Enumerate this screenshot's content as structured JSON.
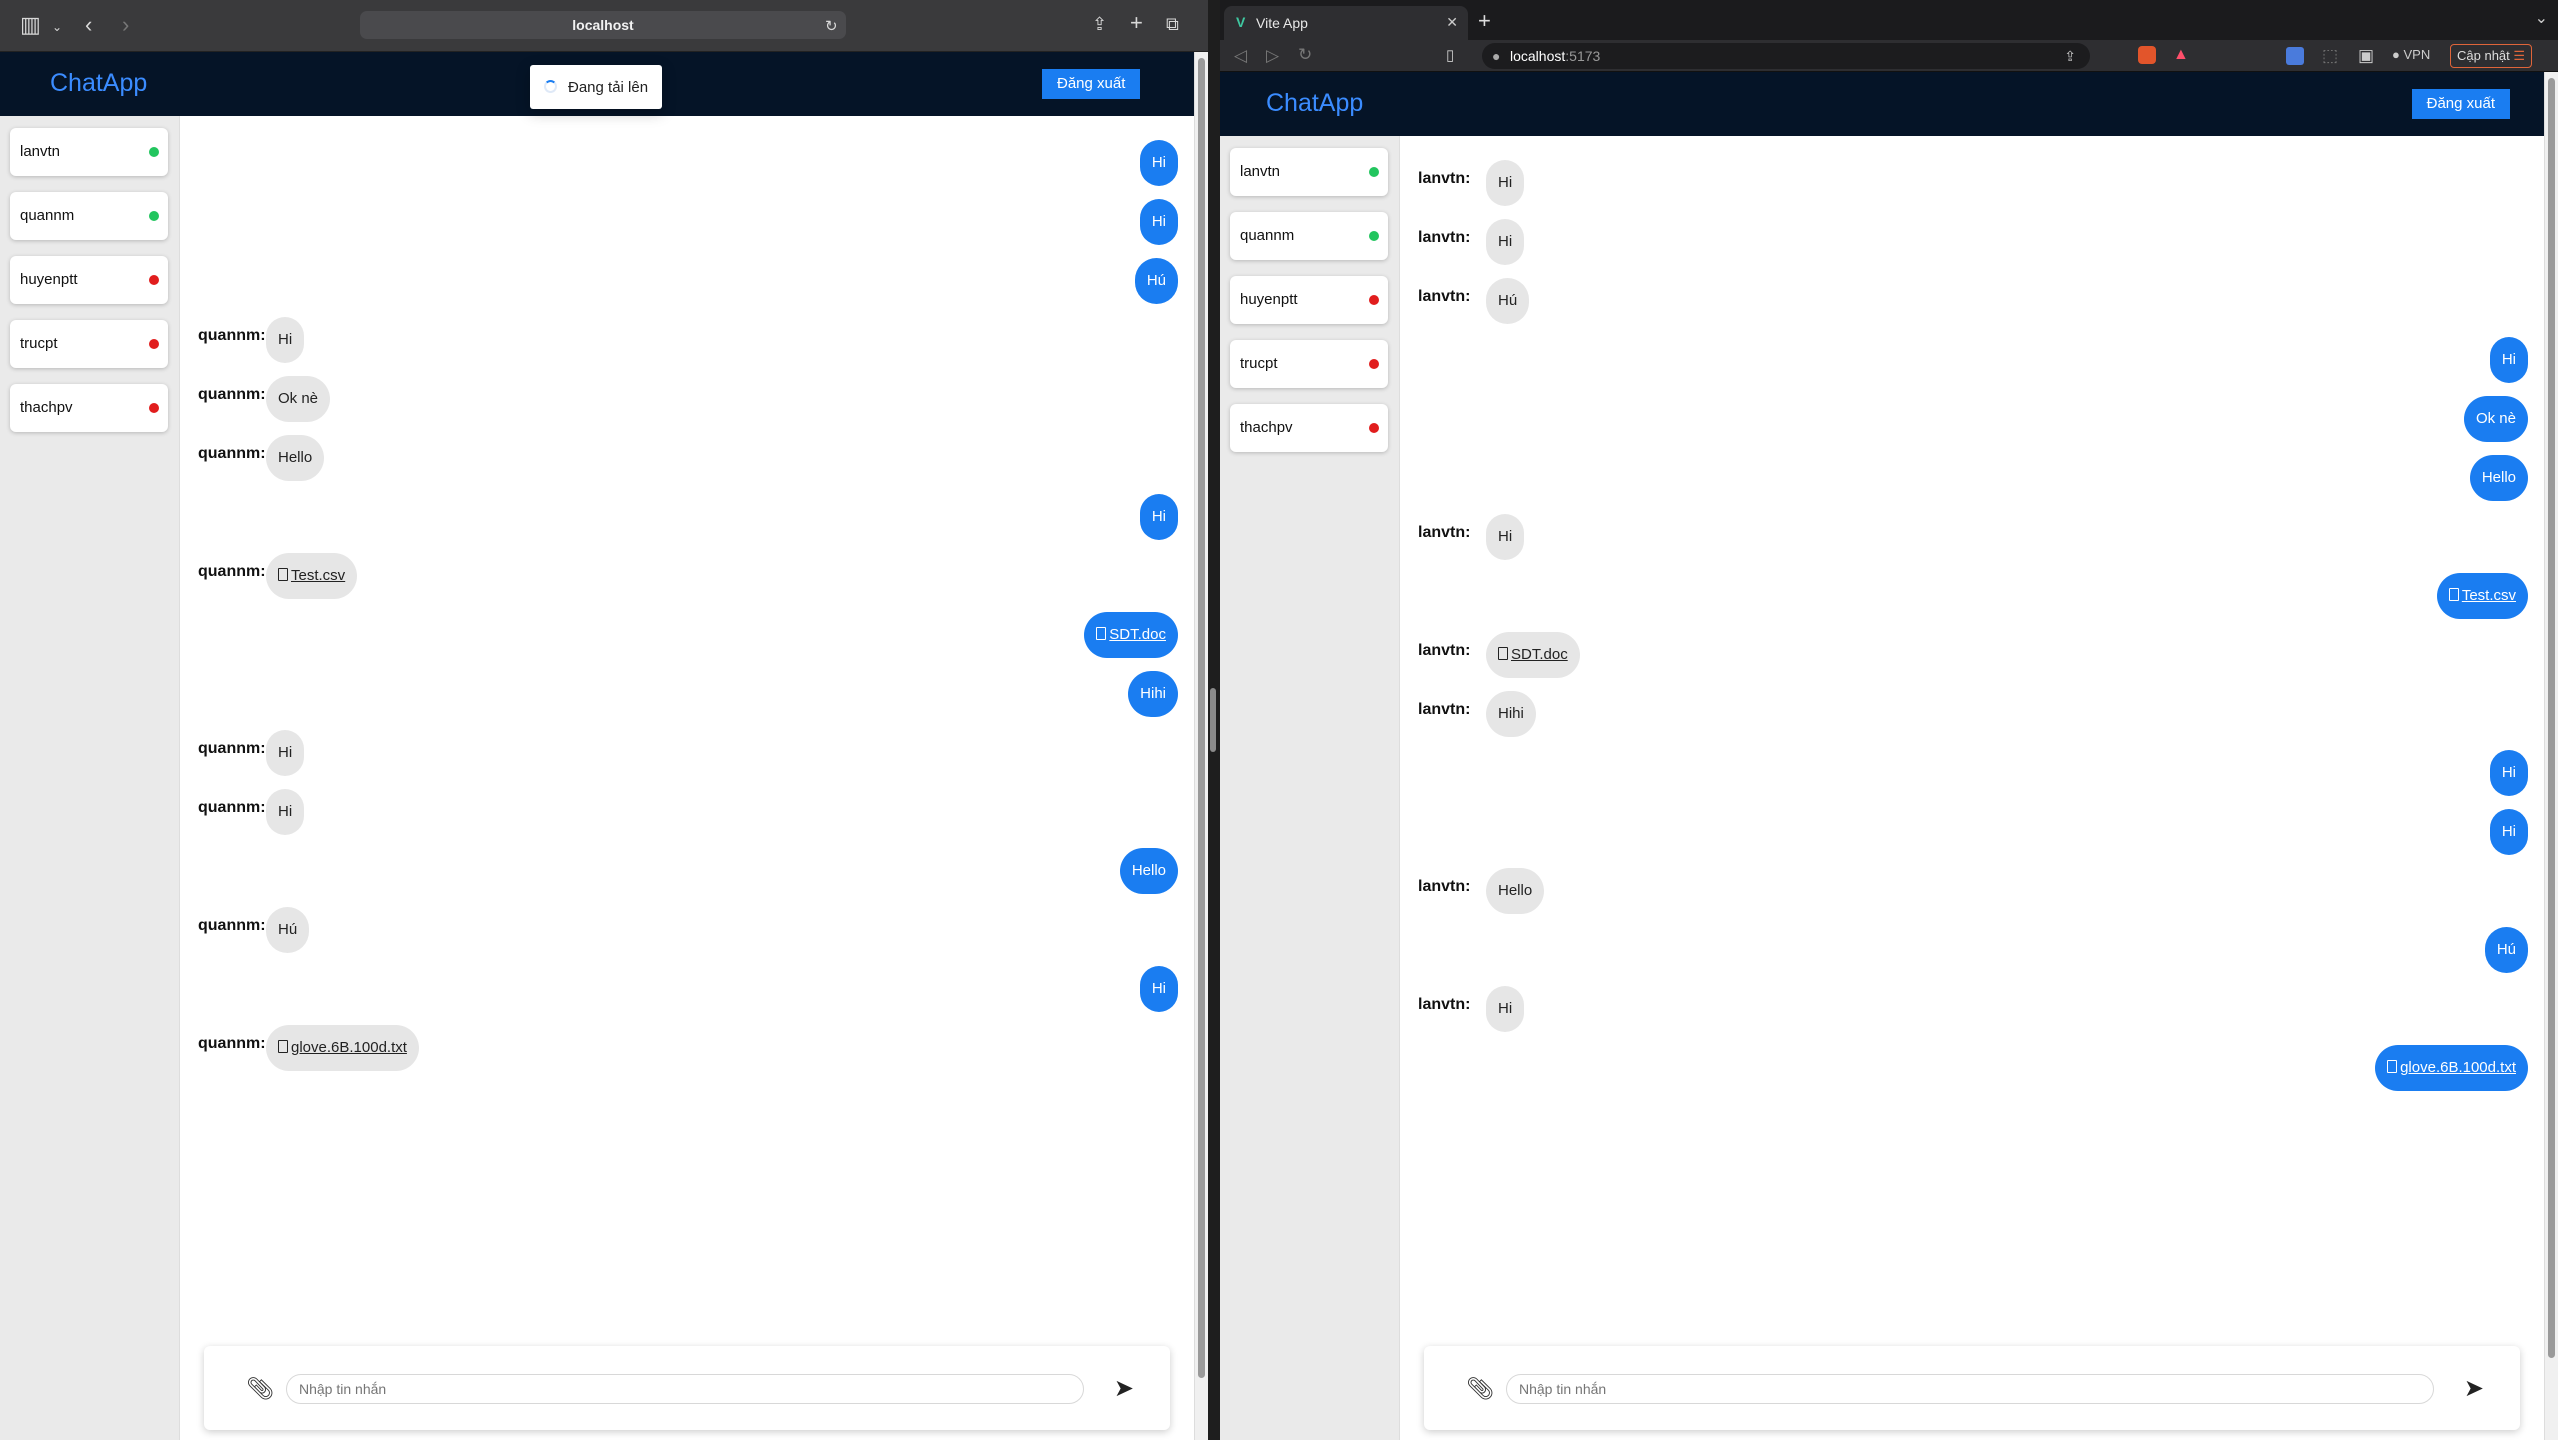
{
  "left_window": {
    "url": "localhost",
    "toast_text": "Đang tải lên",
    "app": {
      "brand": "ChatApp",
      "logout_label": "Đăng xuất",
      "users": [
        {
          "name": "lanvtn",
          "status": "online"
        },
        {
          "name": "quannm",
          "status": "online"
        },
        {
          "name": "huyenptt",
          "status": "offline"
        },
        {
          "name": "trucpt",
          "status": "offline"
        },
        {
          "name": "thachpv",
          "status": "offline"
        }
      ],
      "messages": [
        {
          "side": "out",
          "text": "Hi"
        },
        {
          "side": "out",
          "text": "Hi"
        },
        {
          "side": "out",
          "text": "Hú"
        },
        {
          "side": "in",
          "sender": "quannm:",
          "text": "Hi"
        },
        {
          "side": "in",
          "sender": "quannm:",
          "text": "Ok nè"
        },
        {
          "side": "in",
          "sender": "quannm:",
          "text": "Hello"
        },
        {
          "side": "out",
          "text": "Hi"
        },
        {
          "side": "in",
          "sender": "quannm:",
          "text": "Test.csv",
          "file": true
        },
        {
          "side": "out",
          "text": "SDT.doc",
          "file": true
        },
        {
          "side": "out",
          "text": "Hihi"
        },
        {
          "side": "in",
          "sender": "quannm:",
          "text": "Hi"
        },
        {
          "side": "in",
          "sender": "quannm:",
          "text": "Hi"
        },
        {
          "side": "out",
          "text": "Hello"
        },
        {
          "side": "in",
          "sender": "quannm:",
          "text": "Hú"
        },
        {
          "side": "out",
          "text": "Hi"
        },
        {
          "side": "in",
          "sender": "quannm:",
          "text": "glove.6B.100d.txt",
          "file": true
        }
      ],
      "input_placeholder": "Nhập tin nhắn"
    }
  },
  "right_window": {
    "tab_title": "Vite App",
    "url_host": "localhost",
    "url_port": ":5173",
    "vpn_label": "VPN",
    "update_label": "Cập nhật",
    "app": {
      "brand": "ChatApp",
      "logout_label": "Đăng xuất",
      "users": [
        {
          "name": "lanvtn",
          "status": "online"
        },
        {
          "name": "quannm",
          "status": "online"
        },
        {
          "name": "huyenptt",
          "status": "offline"
        },
        {
          "name": "trucpt",
          "status": "offline"
        },
        {
          "name": "thachpv",
          "status": "offline"
        }
      ],
      "messages": [
        {
          "side": "in",
          "sender": "lanvtn:",
          "text": "Hi"
        },
        {
          "side": "in",
          "sender": "lanvtn:",
          "text": "Hi"
        },
        {
          "side": "in",
          "sender": "lanvtn:",
          "text": "Hú"
        },
        {
          "side": "out",
          "text": "Hi"
        },
        {
          "side": "out",
          "text": "Ok nè"
        },
        {
          "side": "out",
          "text": "Hello"
        },
        {
          "side": "in",
          "sender": "lanvtn:",
          "text": "Hi"
        },
        {
          "side": "out",
          "text": "Test.csv",
          "file": true
        },
        {
          "side": "in",
          "sender": "lanvtn:",
          "text": "SDT.doc",
          "file": true
        },
        {
          "side": "in",
          "sender": "lanvtn:",
          "text": "Hihi"
        },
        {
          "side": "out",
          "text": "Hi"
        },
        {
          "side": "out",
          "text": "Hi"
        },
        {
          "side": "in",
          "sender": "lanvtn:",
          "text": "Hello"
        },
        {
          "side": "out",
          "text": "Hú"
        },
        {
          "side": "in",
          "sender": "lanvtn:",
          "text": "Hi"
        },
        {
          "side": "out",
          "text": "glove.6B.100d.txt",
          "file": true
        }
      ],
      "input_placeholder": "Nhập tin nhắn"
    }
  },
  "colors": {
    "navbar": "#051427",
    "brand": "#3b8cff",
    "accent": "#1a7df1",
    "online": "#22c55e",
    "offline": "#e11d1d",
    "incoming_bubble": "#e6e6e6"
  }
}
